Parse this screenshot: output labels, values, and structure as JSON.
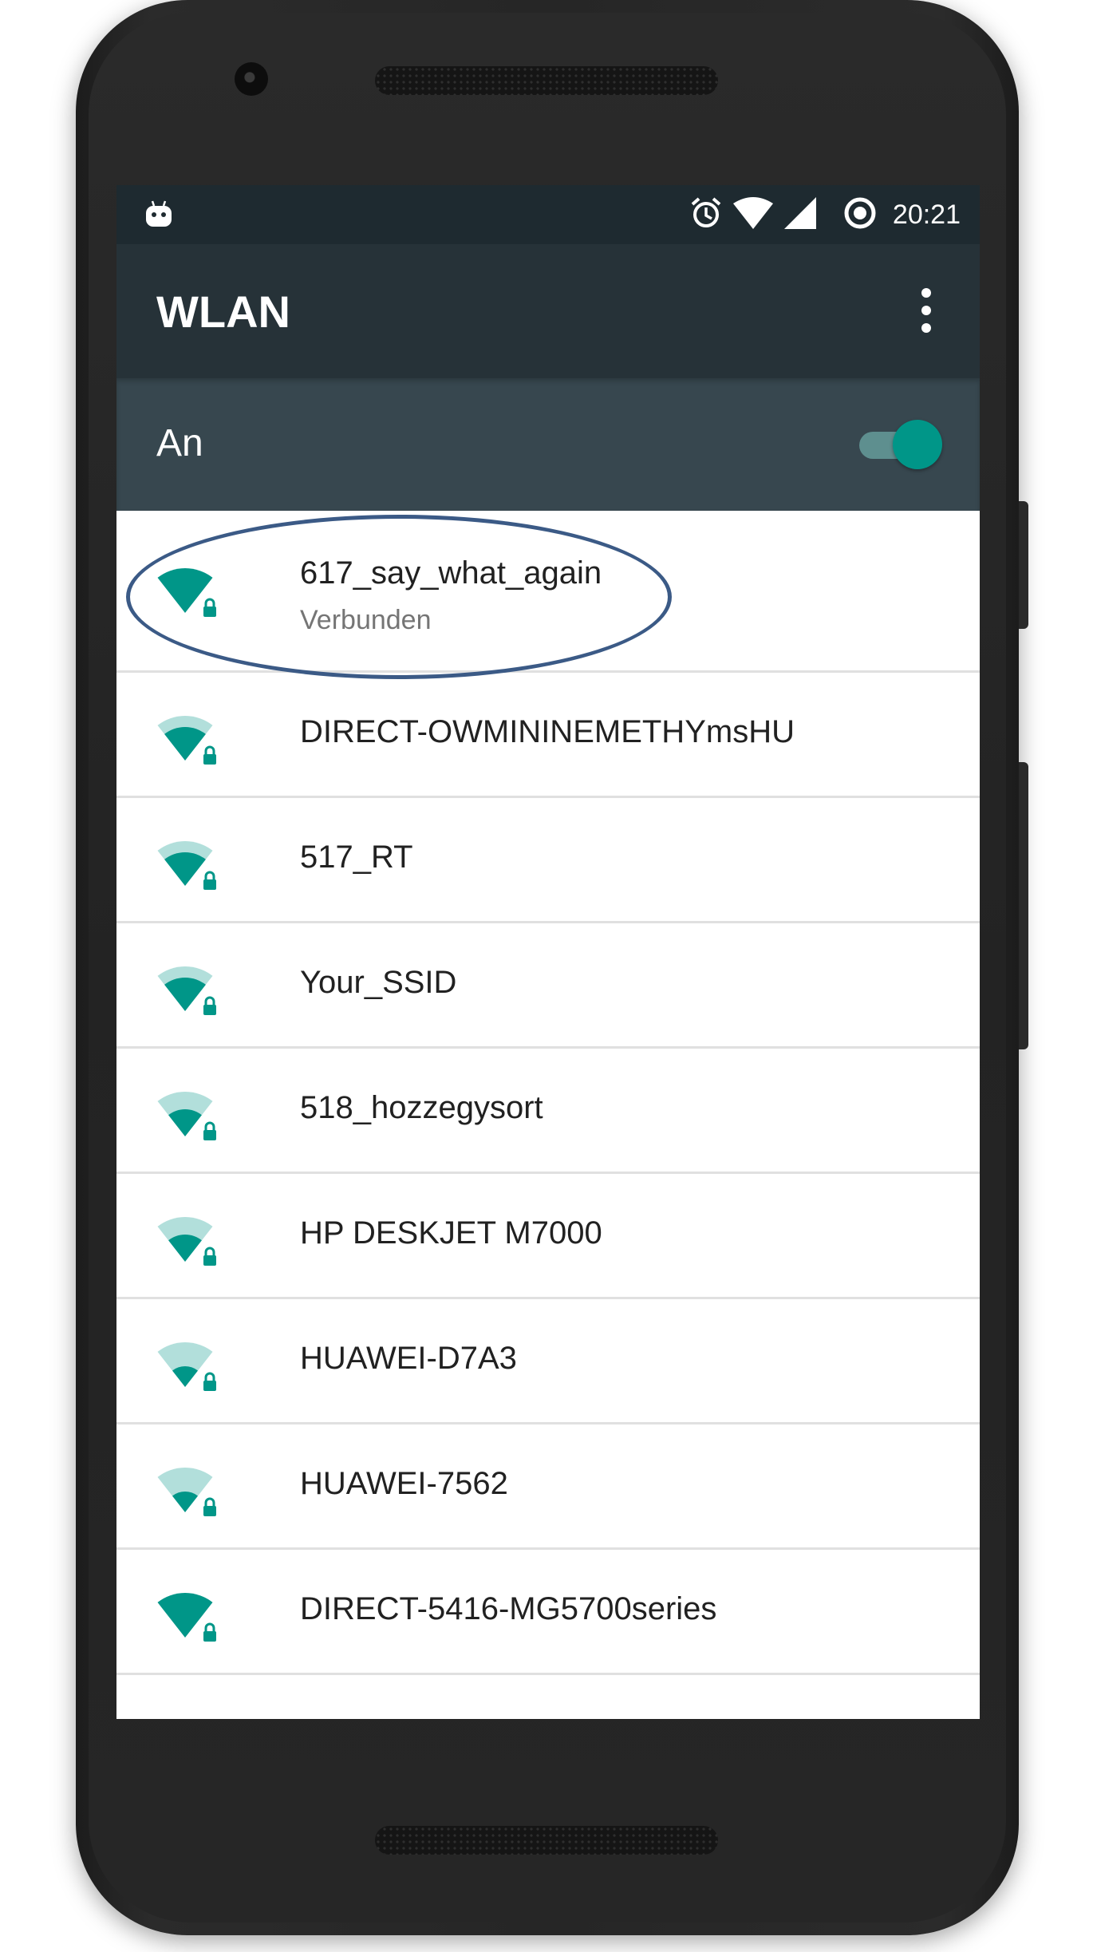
{
  "status_bar": {
    "time": "20:21",
    "icons": [
      "android-robot-icon",
      "alarm-icon",
      "wifi-signal-icon",
      "cell-signal-icon",
      "data-saver-icon"
    ]
  },
  "app_bar": {
    "title": "WLAN",
    "menu_icon": "more-vertical-icon"
  },
  "wlan_switch": {
    "label": "An",
    "state": "on"
  },
  "colors": {
    "accent": "#009688",
    "accent_light": "#b2dfdb",
    "appbar": "#263238",
    "switchbar": "#37474f",
    "highlight_ring": "#3b5a86"
  },
  "networks": [
    {
      "ssid": "617_say_what_again",
      "status": "Verbunden",
      "signal_level": 4,
      "secured": true
    },
    {
      "ssid": "DIRECT-OWMININEMETHYmsHU",
      "signal_level": 3,
      "secured": true
    },
    {
      "ssid": "517_RT",
      "signal_level": 3,
      "secured": true
    },
    {
      "ssid": "Your_SSID",
      "signal_level": 3,
      "secured": true
    },
    {
      "ssid": "518_hozzegysort",
      "signal_level": 2,
      "secured": true
    },
    {
      "ssid": "HP DESKJET M7000",
      "signal_level": 2,
      "secured": true
    },
    {
      "ssid": "HUAWEI-D7A3",
      "signal_level": 1,
      "secured": true
    },
    {
      "ssid": "HUAWEI-7562",
      "signal_level": 1,
      "secured": true
    },
    {
      "ssid": "DIRECT-5416-MG5700series",
      "signal_level": 4,
      "secured": true
    }
  ]
}
